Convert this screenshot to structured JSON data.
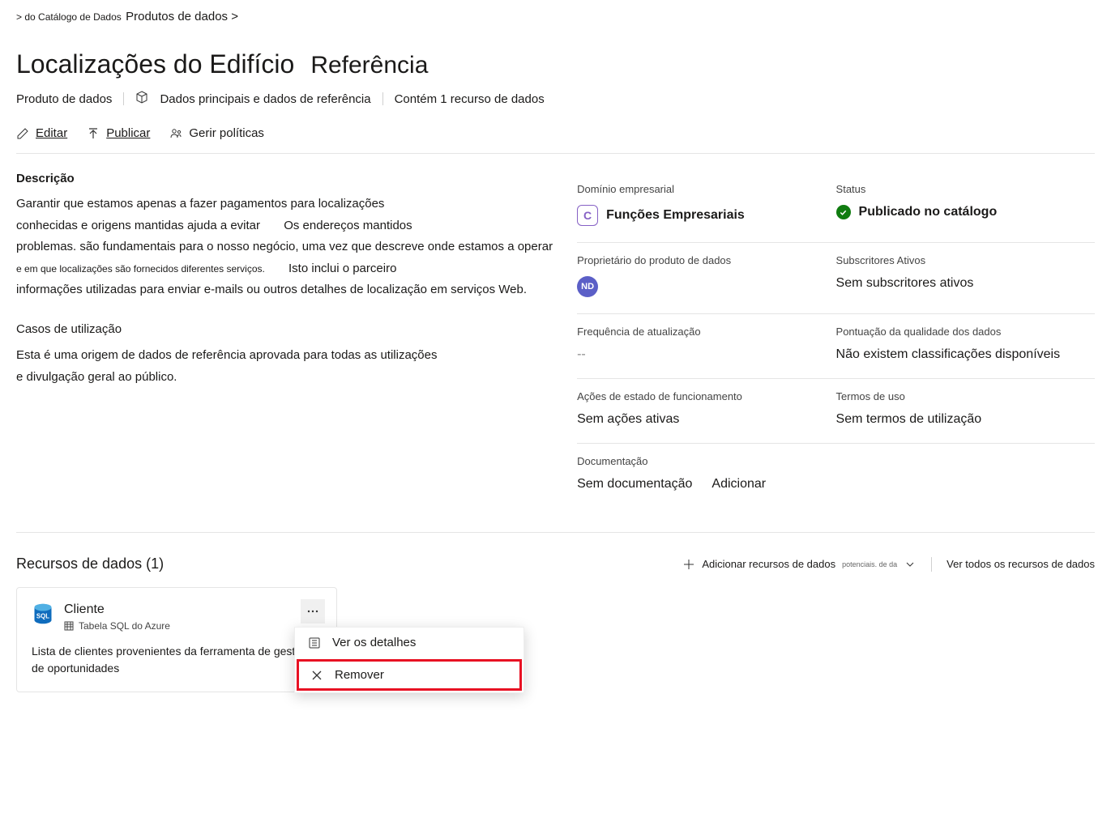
{
  "breadcrumb": {
    "part1": "> do Catálogo de Dados",
    "part2": "Produtos de dados >"
  },
  "title": {
    "main": "Localizações do Edifício",
    "suffix": "Referência"
  },
  "meta": {
    "type_label": "Produto de dados",
    "category": "Dados principais e dados de referência",
    "asset_count": "Contém 1 recurso de dados"
  },
  "actions": {
    "edit": "Editar",
    "publish": "Publicar",
    "manage_policies": "Gerir políticas"
  },
  "description": {
    "heading": "Descrição",
    "line1a": "Garantir que estamos apenas a fazer pagamentos para localizações",
    "line2a": "conhecidas e origens mantidas ajuda a evitar",
    "line2b": "Os endereços mantidos",
    "line3": "problemas. são fundamentais para o nosso negócio, uma vez que descreve onde estamos a operar",
    "line4a": "e em que localizações são fornecidos diferentes serviços.",
    "line4b": "Isto inclui o parceiro",
    "line5": "informações utilizadas para enviar e-mails ou outros detalhes de localização em serviços Web.",
    "usecases_heading": "Casos de utilização",
    "usecases_line1": "Esta é uma origem de dados de referência aprovada para todas as utilizações",
    "usecases_line2": "e divulgação geral ao público."
  },
  "panel": {
    "business_domain_label": "Domínio empresarial",
    "business_domain_badge": "C",
    "business_domain_value": "Funções Empresariais",
    "status_label": "Status",
    "status_value": "Publicado no catálogo",
    "owner_label": "Proprietário do produto de dados",
    "owner_initials": "ND",
    "subscribers_label": "Subscritores Ativos",
    "subscribers_value": "Sem subscritores ativos",
    "frequency_label": "Frequência de atualização",
    "frequency_value": "--",
    "quality_label": "Pontuação da qualidade dos dados",
    "quality_value": "Não existem classificações disponíveis",
    "health_label": "Ações de estado de funcionamento",
    "health_value": "Sem ações ativas",
    "terms_label": "Termos de uso",
    "terms_value": "Sem termos de utilização",
    "docs_label": "Documentação",
    "docs_value": "Sem documentação",
    "docs_add": "Adicionar"
  },
  "resources": {
    "heading": "Recursos de dados (1)",
    "add_label": "Adicionar recursos de dados",
    "add_sub": "potenciais. de da",
    "view_all": "Ver todos os recursos de dados",
    "card": {
      "title": "Cliente",
      "subtitle": "Tabela SQL do Azure",
      "description": "Lista de clientes provenientes da ferramenta de gestão de oportunidades"
    },
    "menu": {
      "view_details": "Ver os detalhes",
      "remove": "Remover"
    }
  }
}
